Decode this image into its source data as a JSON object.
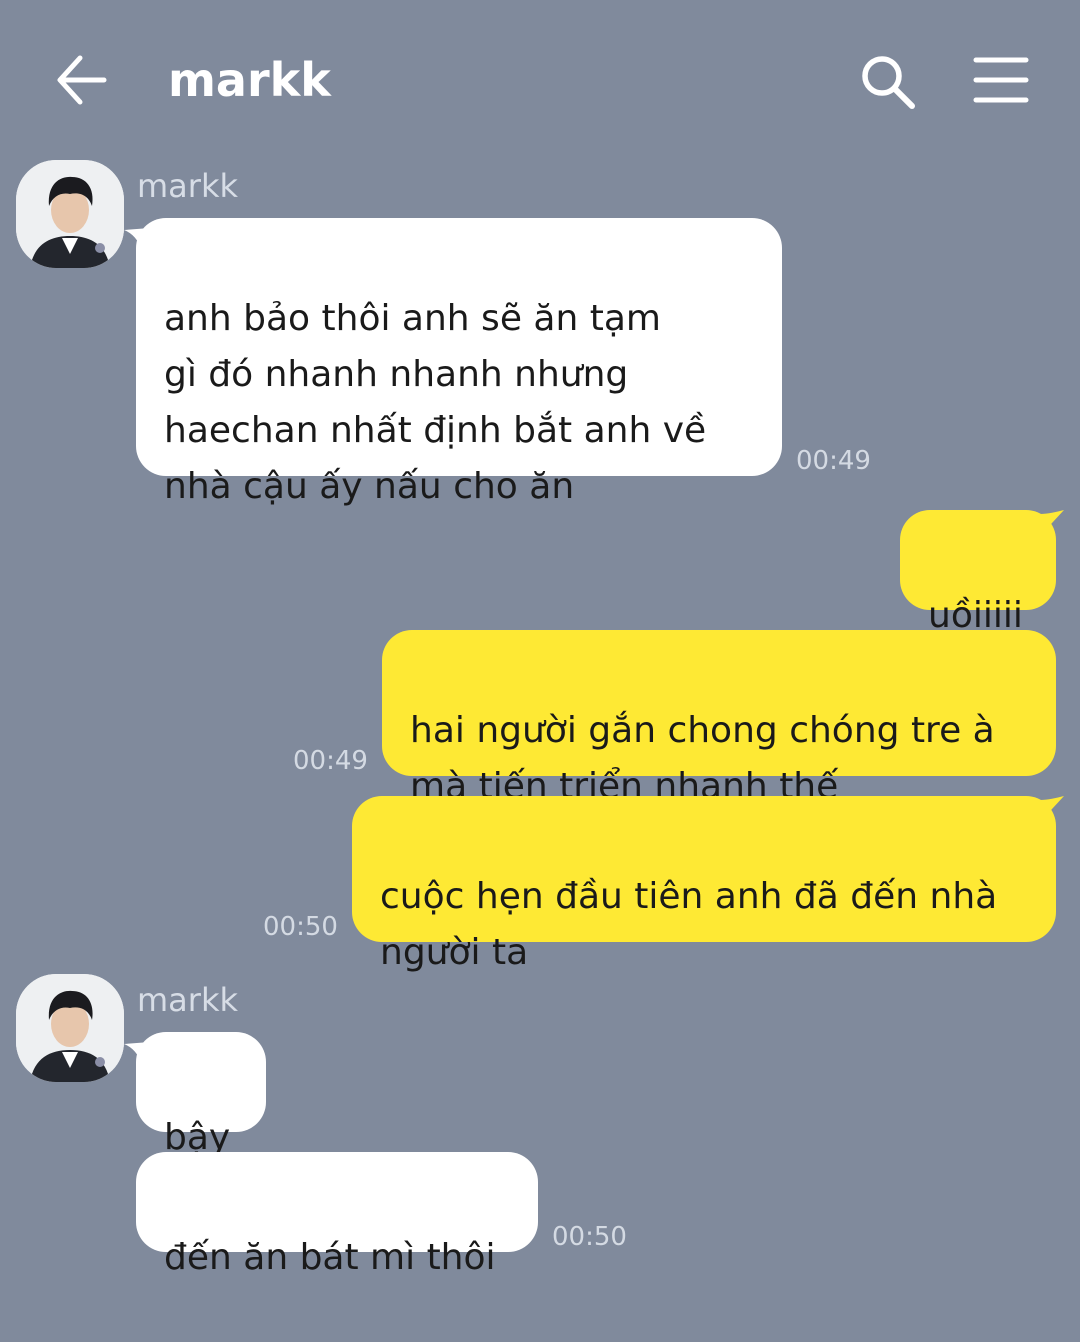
{
  "header": {
    "title": "markk",
    "back_icon": "arrow-left-icon",
    "search_icon": "search-icon",
    "menu_icon": "hamburger-menu-icon"
  },
  "colors": {
    "background": "#808a9c",
    "incoming_bubble": "#ffffff",
    "outgoing_bubble": "#fee934"
  },
  "messages": [
    {
      "direction": "in",
      "sender": "markk",
      "text": "anh bảo thôi anh sẽ ăn tạm\ngì đó nhanh nhanh nhưng\nhaechan nhất định bắt anh về\nnhà cậu ấy nấu cho ăn",
      "time": "00:49"
    },
    {
      "direction": "out",
      "text": "uồiiiii",
      "time": ""
    },
    {
      "direction": "out",
      "text": "hai người gắn chong chóng tre à\nmà tiến triển nhanh thế",
      "time": "00:49"
    },
    {
      "direction": "out",
      "text": "cuộc hẹn đầu tiên anh đã đến nhà\nngười ta",
      "time": "00:50"
    },
    {
      "direction": "in",
      "sender": "markk",
      "text": "bậy",
      "time": ""
    },
    {
      "direction": "in",
      "text": "đến ăn bát mì thôi",
      "time": "00:50"
    }
  ]
}
